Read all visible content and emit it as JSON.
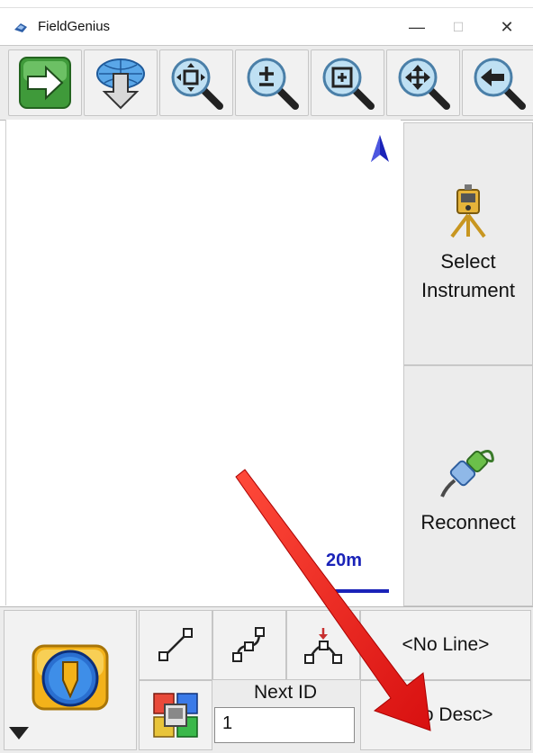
{
  "window": {
    "title": "FieldGenius",
    "minimize_glyph": "—",
    "maximize_glyph": "☐",
    "close_glyph": "✕"
  },
  "toolbar": {
    "buttons": [
      {
        "name": "go-forward-button",
        "icon": "green-right-arrow-icon"
      },
      {
        "name": "globe-download-button",
        "icon": "globe-down-arrow-icon"
      },
      {
        "name": "zoom-extents-button",
        "icon": "zoom-extents-icon"
      },
      {
        "name": "zoom-in-out-button",
        "icon": "zoom-plus-minus-icon"
      },
      {
        "name": "zoom-window-button",
        "icon": "zoom-window-icon"
      },
      {
        "name": "pan-button",
        "icon": "pan-move-icon"
      },
      {
        "name": "zoom-previous-button",
        "icon": "zoom-back-icon"
      }
    ]
  },
  "map": {
    "scale_label": "20m",
    "north_icon": "north-arrow-icon"
  },
  "side_panel": {
    "select_instrument_label": "Select Instrument",
    "reconnect_label": "Reconnect"
  },
  "bottom_bar": {
    "line_label": "<No Line>",
    "desc_label": "<No Desc>",
    "next_id_label": "Next ID",
    "next_id_value": "1"
  },
  "colors": {
    "accent_blue": "#1a23b8",
    "annotation_red": "#e01a1a"
  }
}
